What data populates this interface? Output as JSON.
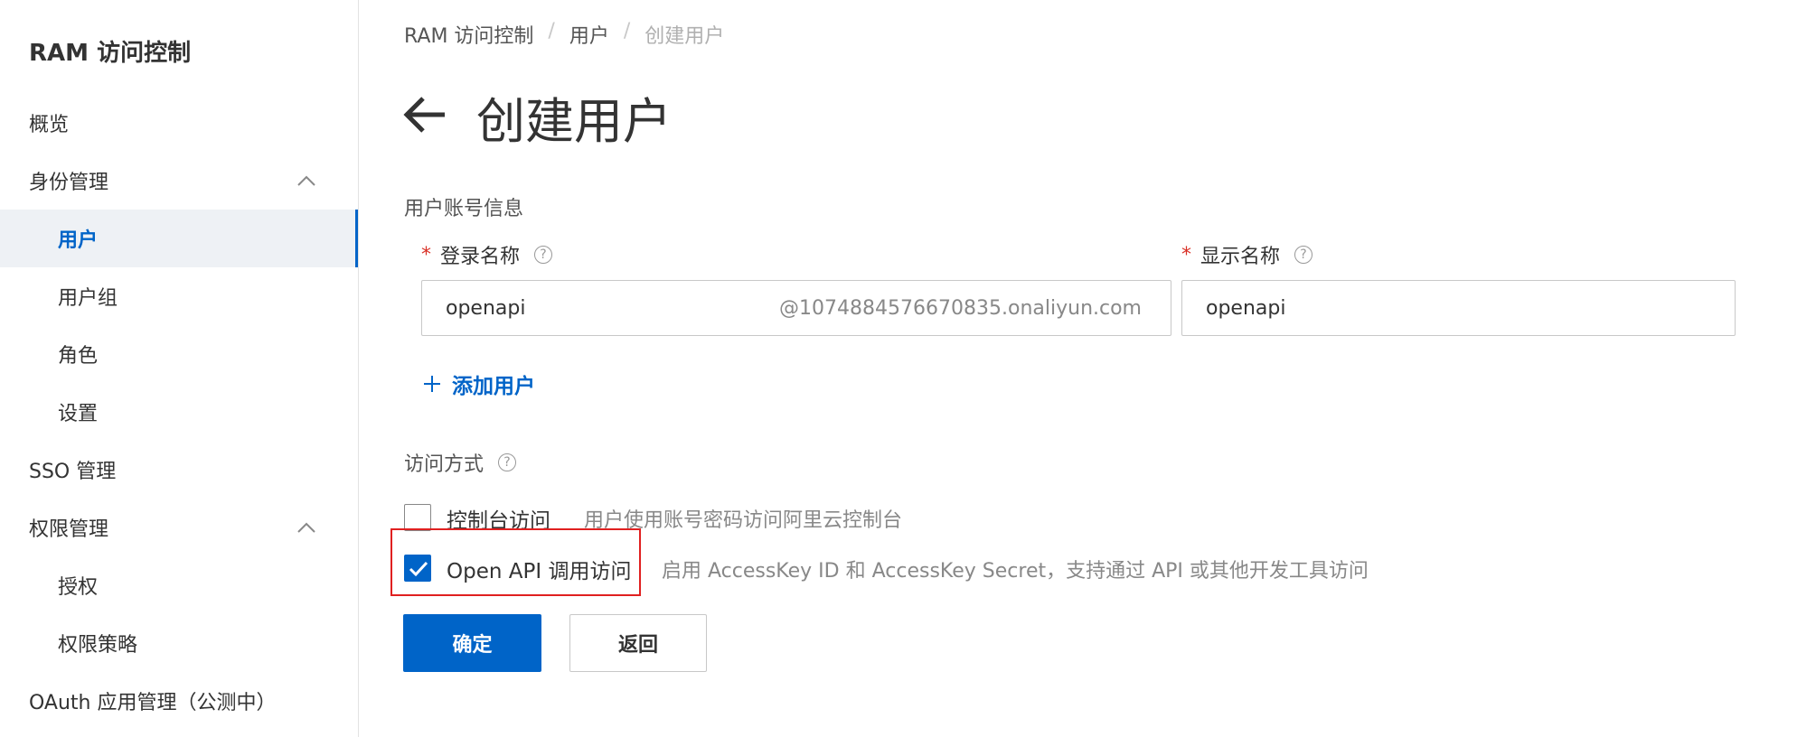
{
  "sidebar": {
    "title": "RAM 访问控制",
    "items": [
      {
        "label": "概览"
      },
      {
        "label": "身份管理"
      },
      {
        "label": "用户"
      },
      {
        "label": "用户组"
      },
      {
        "label": "角色"
      },
      {
        "label": "设置"
      },
      {
        "label": "SSO 管理"
      },
      {
        "label": "权限管理"
      },
      {
        "label": "授权"
      },
      {
        "label": "权限策略"
      },
      {
        "label": "OAuth 应用管理（公测中）"
      }
    ]
  },
  "breadcrumb": [
    "RAM 访问控制",
    "用户",
    "创建用户"
  ],
  "page": {
    "title": "创建用户",
    "account_section": "用户账号信息",
    "login_name_label": "登录名称",
    "display_name_label": "显示名称",
    "login_name_value": "openapi",
    "login_name_suffix": "@1074884576670835.onaliyun.com",
    "display_name_value": "openapi",
    "add_user": "添加用户",
    "access_section": "访问方式",
    "console_access_label": "控制台访问",
    "console_access_desc": "用户使用账号密码访问阿里云控制台",
    "console_access_checked": false,
    "api_access_label": "Open API 调用访问",
    "api_access_desc": "启用 AccessKey ID 和 AccessKey Secret，支持通过 API 或其他开发工具访问",
    "api_access_checked": true,
    "confirm_button": "确定",
    "back_button": "返回",
    "help_glyph": "?"
  },
  "colors": {
    "primary": "#0064c8",
    "required": "#d93026",
    "highlight": "#e02020",
    "active_bg": "#eef1f5"
  }
}
